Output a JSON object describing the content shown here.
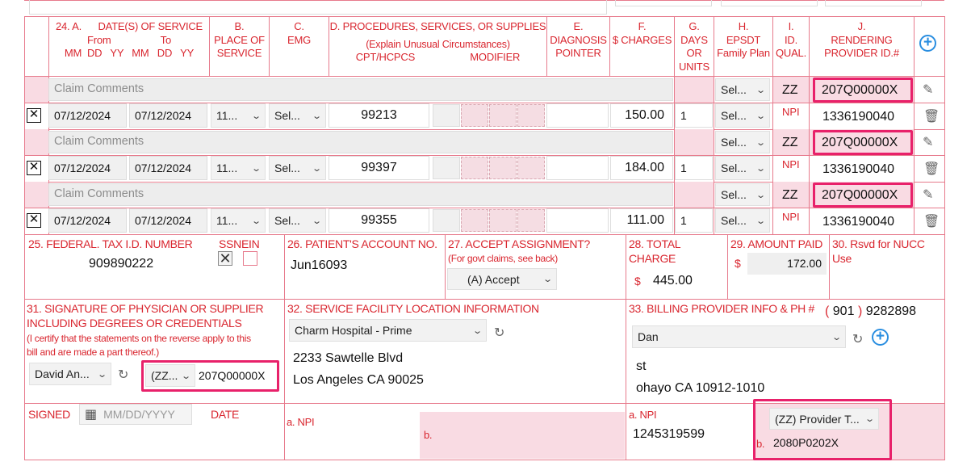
{
  "header": {
    "c24a": [
      "24. A.      DATE(S) OF SERVICE",
      "From                  To",
      "MM  DD   YY   MM   DD   YY"
    ],
    "c24b": [
      "B.",
      "PLACE OF",
      "SERVICE"
    ],
    "c24c": [
      "C.",
      "EMG"
    ],
    "c24d": [
      "D. PROCEDURES, SERVICES, OR SUPPLIES",
      "(Explain Unusual Circumstances)",
      "CPT/HCPCS                    MODIFIER"
    ],
    "c24e": [
      "E.",
      "DIAGNOSIS",
      "POINTER"
    ],
    "c24f": [
      "F.",
      "$ CHARGES"
    ],
    "c24g": [
      "G.",
      "DAYS",
      "OR",
      "UNITS"
    ],
    "c24h": [
      "H.",
      "EPSDT",
      "Family Plan"
    ],
    "c24i": [
      "I.",
      "ID.",
      "QUAL."
    ],
    "c24j": [
      "J.",
      "RENDERING",
      "PROVIDER ID.#"
    ]
  },
  "lines": [
    {
      "comment_placeholder": "Claim Comments",
      "from": "07/12/2024",
      "to": "07/12/2024",
      "pos": "11...",
      "emg": "Sel...",
      "cpt": "99213",
      "charges": "150.00",
      "units": "1",
      "epsdt1": "Sel...",
      "epsdt2": "Sel...",
      "qual": "ZZ",
      "npi_label": "NPI",
      "rendering_id": "207Q00000X",
      "npi": "1336190040"
    },
    {
      "comment_placeholder": "Claim Comments",
      "from": "07/12/2024",
      "to": "07/12/2024",
      "pos": "11...",
      "emg": "Sel...",
      "cpt": "99397",
      "charges": "184.00",
      "units": "1",
      "epsdt1": "Sel...",
      "epsdt2": "Sel...",
      "qual": "ZZ",
      "npi_label": "NPI",
      "rendering_id": "207Q00000X",
      "npi": "1336190040"
    },
    {
      "comment_placeholder": "Claim Comments",
      "from": "07/12/2024",
      "to": "07/12/2024",
      "pos": "11...",
      "emg": "Sel...",
      "cpt": "99355",
      "charges": "111.00",
      "units": "1",
      "epsdt1": "Sel...",
      "epsdt2": "Sel...",
      "qual": "ZZ",
      "npi_label": "NPI",
      "rendering_id": "207Q00000X",
      "npi": "1336190040"
    }
  ],
  "box25": {
    "label": "25. FEDERAL. TAX I.D. NUMBER",
    "value": "909890222",
    "ssn": "SSN",
    "ein": "EIN"
  },
  "box26": {
    "label": "26. PATIENT'S ACCOUNT NO.",
    "value": "Jun16093"
  },
  "box27": {
    "label": "27. ACCEPT ASSIGNMENT?",
    "sub": "(For govt claims, see back)",
    "value": "(A) Accept"
  },
  "box28": {
    "label": "28. TOTAL",
    "label2": "CHARGE",
    "currency": "$",
    "value": "445.00"
  },
  "box29": {
    "label": "29. AMOUNT PAID",
    "currency": "$",
    "value": "172.00"
  },
  "box30": {
    "label": "30. Rsvd for NUCC",
    "label2": "Use"
  },
  "box31": {
    "label1": "31. SIGNATURE OF PHYSICIAN OR SUPPLIER",
    "label2": "INCLUDING DEGREES OR CREDENTIALS",
    "cert1": "(I certify that the statements on the reverse apply to this",
    "cert2": "bill and are made a part thereof.)",
    "physician": "David An...",
    "qual": "(ZZ...",
    "id": "207Q00000X",
    "signed": "SIGNED",
    "date_placeholder": "MM/DD/YYYY",
    "date": "DATE"
  },
  "box32": {
    "label": "32. SERVICE FACILITY LOCATION INFORMATION",
    "facility": "Charm Hospital - Prime",
    "addr1": "2233 Sawtelle Blvd",
    "addr2": "Los Angeles CA 90025",
    "npi_label": "a. NPI",
    "b_label": "b."
  },
  "box33": {
    "label": "33. BILLING PROVIDER INFO & PH #",
    "area_open": "(",
    "area": "901",
    "area_close": ")",
    "phone": "9282898",
    "provider": "Dan",
    "addr1": "st",
    "addr2": "ohayo CA 10912-1010",
    "npi_label": "a. NPI",
    "npi": "1245319599",
    "qual": "(ZZ) Provider T...",
    "b_label": "b.",
    "b_value": "2080P0202X"
  }
}
